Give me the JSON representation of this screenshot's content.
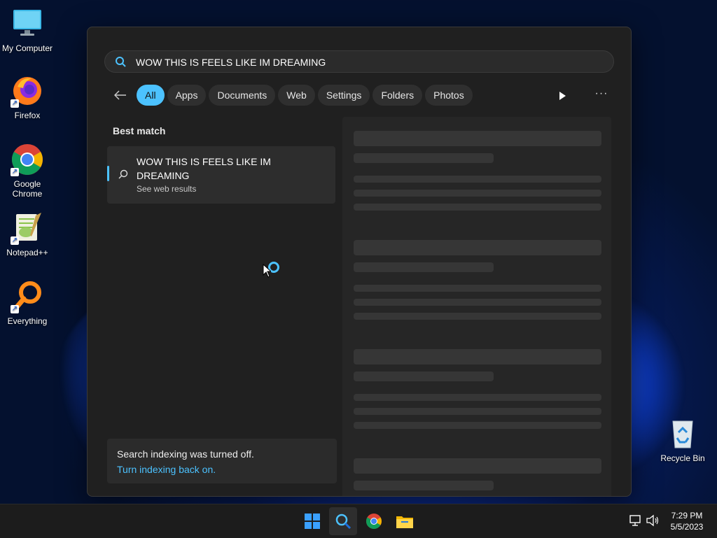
{
  "desktop": {
    "icons": [
      {
        "label": "My Computer"
      },
      {
        "label": "Firefox"
      },
      {
        "label": "Google Chrome"
      },
      {
        "label": "Notepad++"
      },
      {
        "label": "Everything"
      },
      {
        "label": "Recycle Bin"
      }
    ]
  },
  "search": {
    "query": "WOW THIS IS FEELS LIKE IM DREAMING"
  },
  "filters": {
    "items": [
      {
        "label": "All",
        "active": true
      },
      {
        "label": "Apps"
      },
      {
        "label": "Documents"
      },
      {
        "label": "Web"
      },
      {
        "label": "Settings"
      },
      {
        "label": "Folders"
      },
      {
        "label": "Photos"
      }
    ],
    "more": "···"
  },
  "results": {
    "best_match_label": "Best match",
    "best_item_title": "WOW THIS IS FEELS LIKE IM DREAMING",
    "best_item_subtitle": "See web results"
  },
  "notice": {
    "line1": "Search indexing was turned off.",
    "link": "Turn indexing back on."
  },
  "taskbar": {
    "time": "7:29 PM",
    "date": "5/5/2023"
  },
  "colors": {
    "accent": "#4cc2ff",
    "panel": "#202020",
    "taskbar": "#1c1c1c"
  }
}
